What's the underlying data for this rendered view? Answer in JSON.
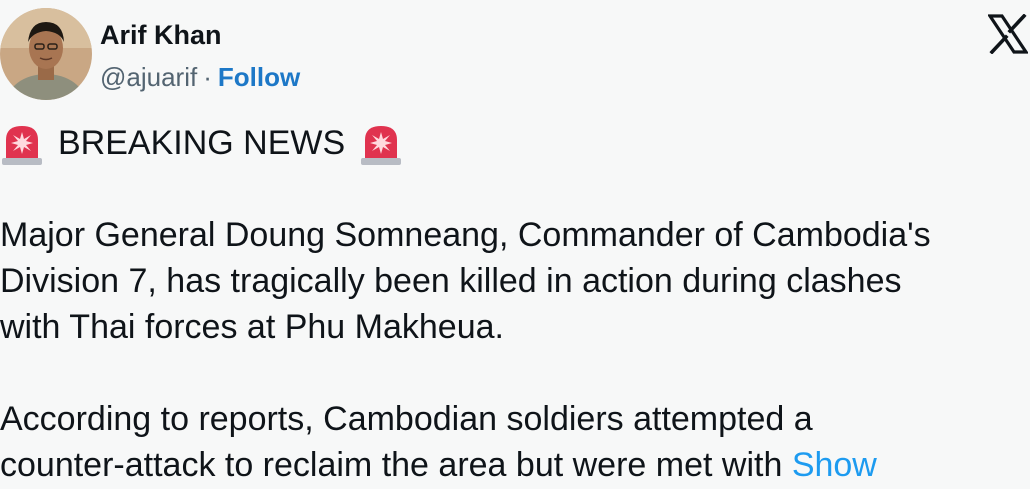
{
  "author": {
    "display_name": "Arif Khan",
    "handle": "@ajuarif",
    "separator": "·",
    "follow_label": "Follow"
  },
  "brand": {
    "logo_icon": "x-logo-icon"
  },
  "tweet": {
    "headline": "BREAKING NEWS",
    "headline_icon": "police-siren-icon",
    "lines": [
      "Major General Doung Somneang, Commander of Cambodia's",
      "Division 7, has tragically been killed in action during clashes",
      "with Thai forces at Phu Makheua.",
      "According to reports, Cambodian soldiers attempted a",
      "counter-attack to reclaim the area but were met with"
    ],
    "show_more_label": "Show"
  },
  "colors": {
    "background": "#f7f8f8",
    "text": "#0f1419",
    "secondary_text": "#536471",
    "follow": "#1d78c7",
    "link": "#1d9bf0",
    "siren": "#e0334f"
  }
}
